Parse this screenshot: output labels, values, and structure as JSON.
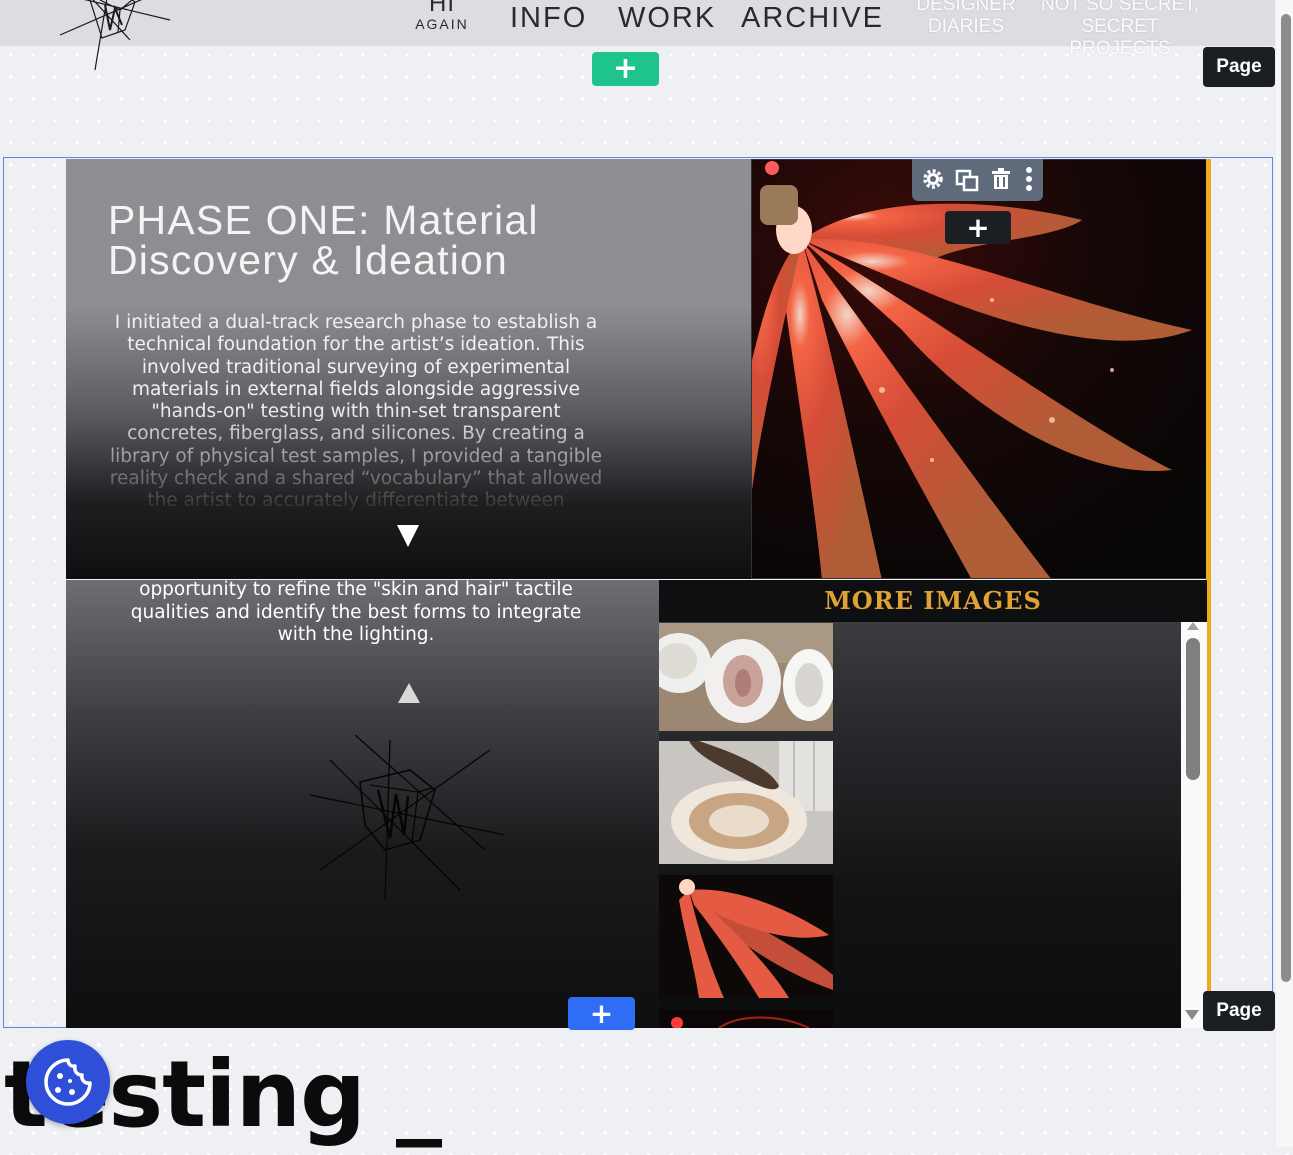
{
  "nav": {
    "hi_top": "HI",
    "hi_bottom": "AGAIN",
    "info": "INFO",
    "work": "WORK",
    "archive": "ARCHIVE",
    "designer_diaries": "DESIGNER DIARIES",
    "secret_projects": "NOT SO SECRET, SECRET PROJECTS"
  },
  "editor": {
    "add_symbol": "+",
    "page_label_top": "Page",
    "page_label_bottom": "Page",
    "toolbar_icons": [
      "gear-icon",
      "duplicate-icon",
      "trash-icon",
      "more-vertical-icon"
    ]
  },
  "phase": {
    "title": "PHASE ONE: Material Discovery & Ideation",
    "body": "I initiated a dual-track research phase to establish a technical foundation for the artist’s ideation. This involved traditional surveying of experimental materials in external fields alongside aggressive \"hands-on\" testing with thin-set transparent concretes, fiberglass, and silicones. By creating a library of physical test samples, I provided a tangible reality check and a shared “vocabulary” that allowed the artist to accurately differentiate between",
    "continued": "opportunity to refine the \"skin and hair\" tactile qualities and identify the best forms to integrate with the lighting."
  },
  "gallery": {
    "header": "MORE IMAGES",
    "thumbnails": [
      "plaster-molds",
      "hand-on-cast",
      "glowing-silicone-leaf",
      "red-lights"
    ]
  },
  "footer": {
    "heading": "testing _"
  },
  "colors": {
    "accent_orange": "#f0ac1c",
    "add_green": "#1fc48d",
    "add_blue": "#2f6df5",
    "cookie_blue": "#2f4fd8",
    "more_images_gold": "#e0a234"
  }
}
